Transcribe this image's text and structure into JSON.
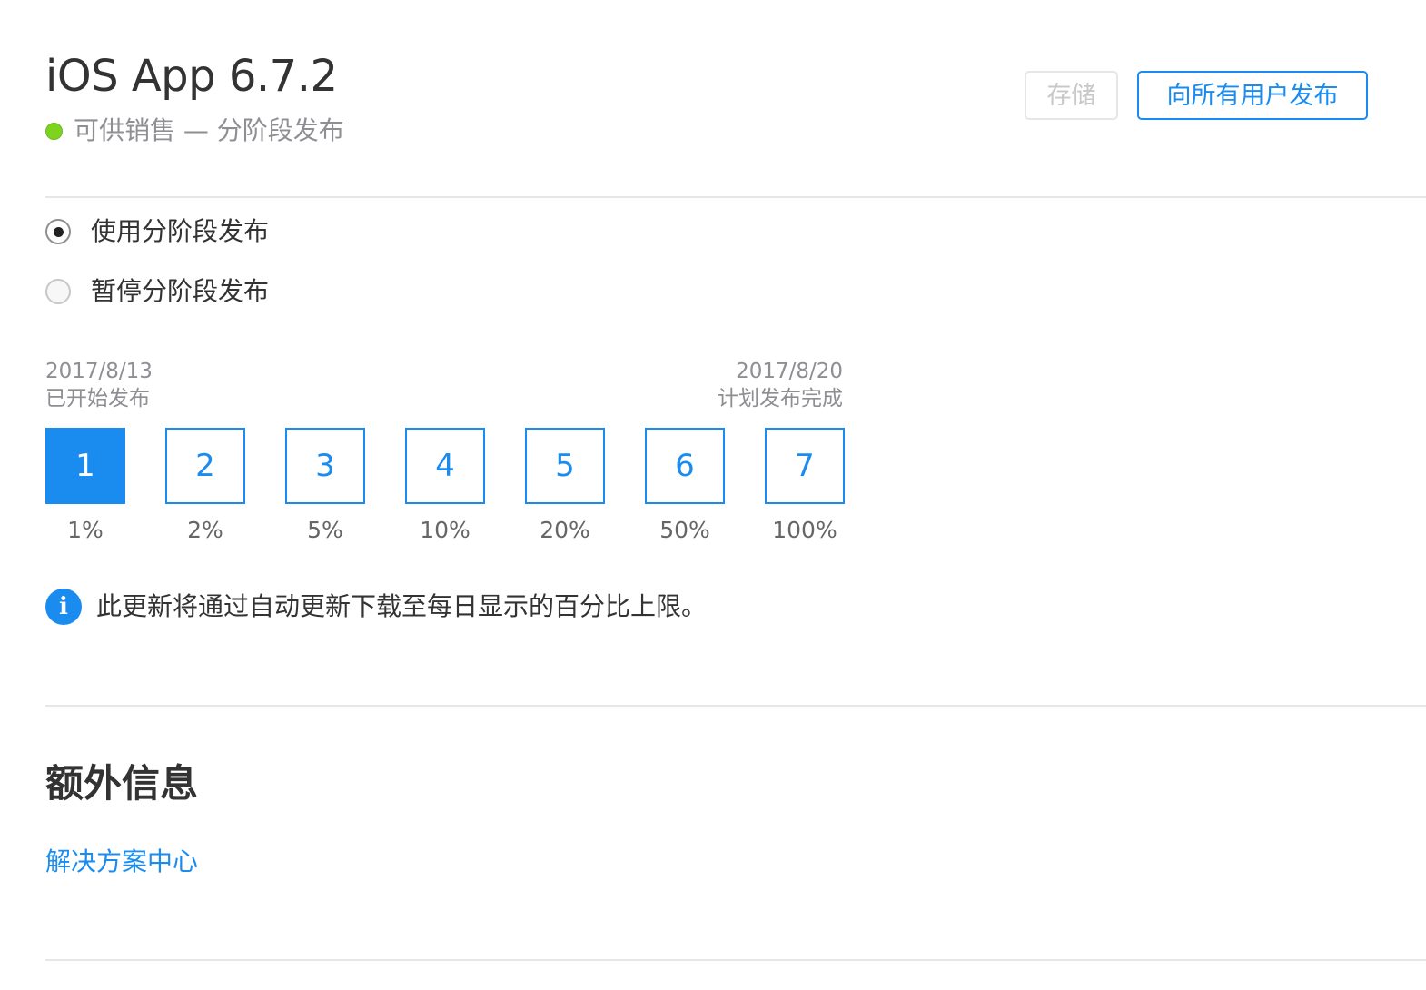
{
  "header": {
    "title": "iOS App 6.7.2",
    "status_text": "可供销售 — 分阶段发布",
    "status_color": "#7ed321"
  },
  "toolbar": {
    "save_label": "存储",
    "save_enabled": false,
    "release_label": "向所有用户发布"
  },
  "release_options": [
    {
      "label": "使用分阶段发布",
      "selected": true
    },
    {
      "label": "暂停分阶段发布",
      "selected": false
    }
  ],
  "timeline": {
    "start_date": "2017/8/13",
    "start_label": "已开始发布",
    "end_date": "2017/8/20",
    "end_label": "计划发布完成"
  },
  "phases": [
    {
      "day": "1",
      "percent": "1%",
      "active": true
    },
    {
      "day": "2",
      "percent": "2%",
      "active": false
    },
    {
      "day": "3",
      "percent": "5%",
      "active": false
    },
    {
      "day": "4",
      "percent": "10%",
      "active": false
    },
    {
      "day": "5",
      "percent": "20%",
      "active": false
    },
    {
      "day": "6",
      "percent": "50%",
      "active": false
    },
    {
      "day": "7",
      "percent": "100%",
      "active": false
    }
  ],
  "info": {
    "icon": "info-icon",
    "text": "此更新将通过自动更新下载至每日显示的百分比上限。"
  },
  "additional": {
    "title": "额外信息",
    "link_label": "解决方案中心"
  },
  "colors": {
    "accent": "#1a8cf0",
    "status_green": "#7ed321",
    "divider": "#e6e6e6"
  }
}
